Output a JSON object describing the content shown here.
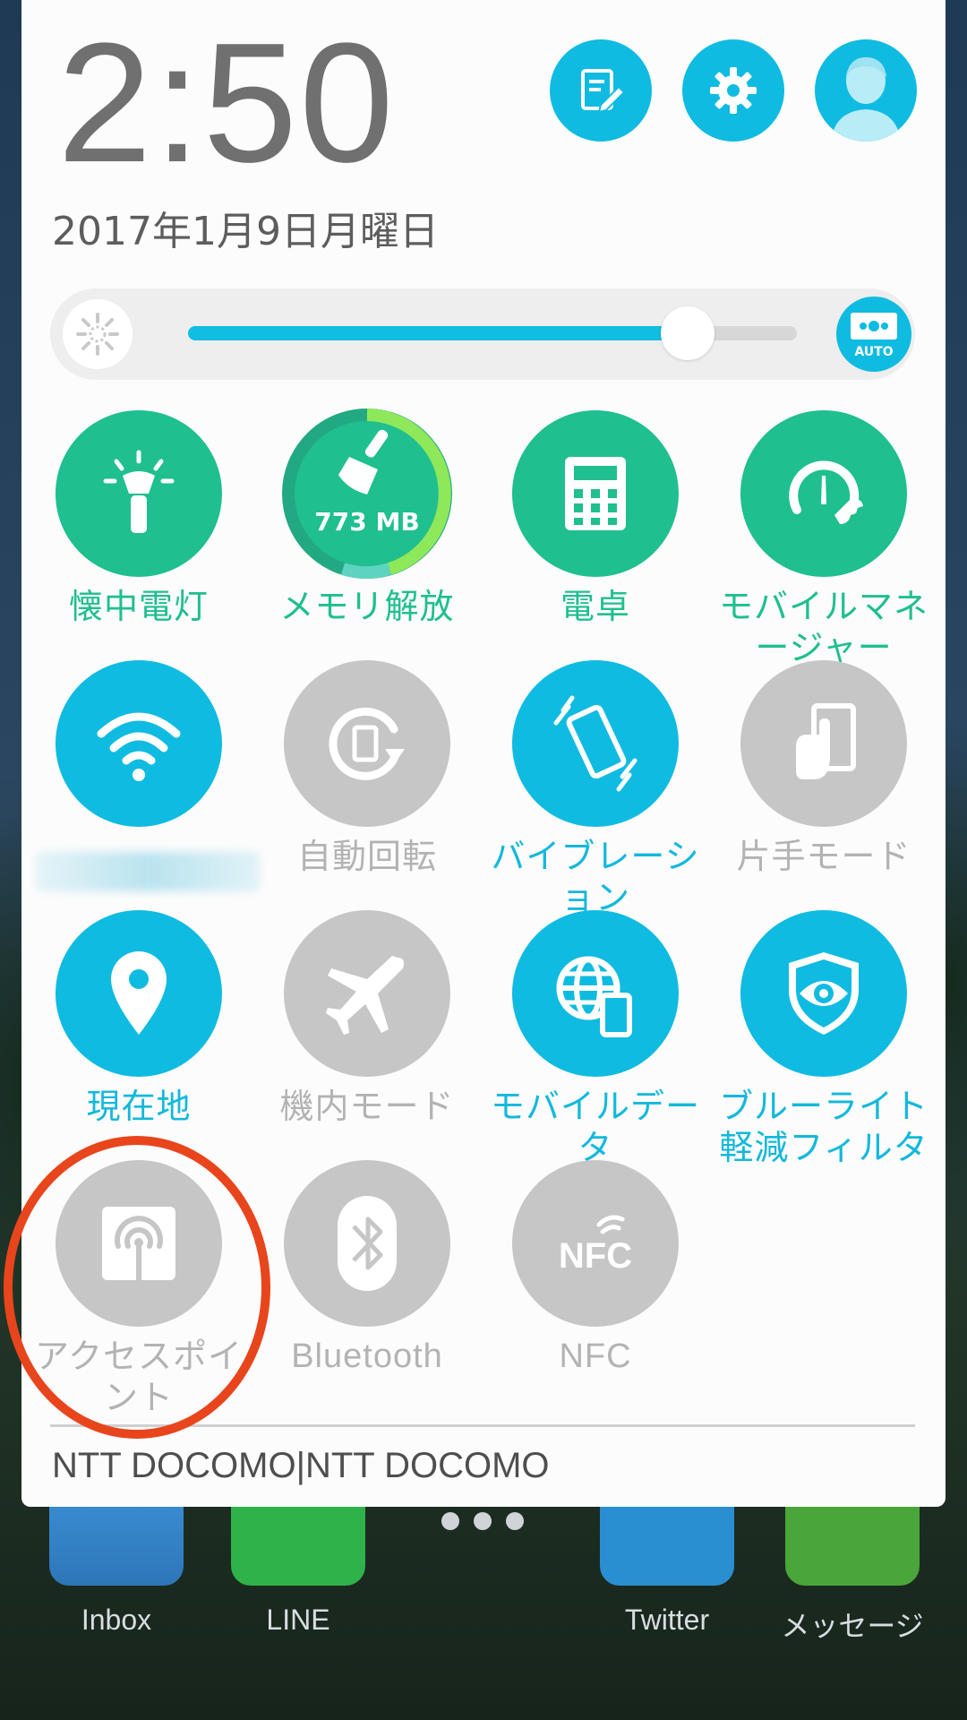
{
  "status": {
    "time": "2:50",
    "date": "2017年1月9日月曜日"
  },
  "header_buttons": [
    {
      "name": "edit-quick-settings",
      "icon": "edit-icon"
    },
    {
      "name": "settings",
      "icon": "gear-icon"
    },
    {
      "name": "user",
      "icon": "user-avatar-icon"
    }
  ],
  "brightness": {
    "level_fraction": 0.82,
    "auto_label": "AUTO"
  },
  "tiles": [
    {
      "label": "懐中電灯",
      "icon": "flashlight-icon",
      "state": "on-green"
    },
    {
      "label": "メモリ解放",
      "icon": "broom-icon",
      "state": "on-green",
      "value": "773 MB"
    },
    {
      "label": "電卓",
      "icon": "calculator-icon",
      "state": "on-green"
    },
    {
      "label": "モバイルマネージャー",
      "icon": "mobile-manager-icon",
      "state": "on-green"
    },
    {
      "label": "",
      "icon": "wifi-icon",
      "state": "on-blue"
    },
    {
      "label": "自動回転",
      "icon": "auto-rotate-icon",
      "state": "off"
    },
    {
      "label": "バイブレーション",
      "icon": "vibration-icon",
      "state": "on-blue"
    },
    {
      "label": "片手モード",
      "icon": "one-hand-mode-icon",
      "state": "off"
    },
    {
      "label": "現在地",
      "icon": "location-pin-icon",
      "state": "on-blue"
    },
    {
      "label": "機内モード",
      "icon": "airplane-icon",
      "state": "off"
    },
    {
      "label": "モバイルデータ",
      "icon": "mobile-data-icon",
      "state": "on-blue"
    },
    {
      "label": "ブルーライト軽減フィルタ",
      "icon": "eye-shield-icon",
      "state": "on-blue"
    },
    {
      "label": "アクセスポイント",
      "icon": "hotspot-icon",
      "state": "off"
    },
    {
      "label": "Bluetooth",
      "icon": "bluetooth-icon",
      "state": "off"
    },
    {
      "label": "NFC",
      "icon": "nfc-icon",
      "state": "off"
    }
  ],
  "carrier": "NTT DOCOMO|NTT DOCOMO",
  "dock": [
    {
      "label": "Inbox",
      "icon": "inbox-icon"
    },
    {
      "label": "LINE",
      "icon": "line-icon"
    },
    {
      "label": "",
      "icon": "app-drawer-icon"
    },
    {
      "label": "Twitter",
      "icon": "twitter-icon"
    },
    {
      "label": "メッセージ",
      "icon": "messages-icon"
    }
  ],
  "colors": {
    "accent_blue": "#0fbbe1",
    "accent_green": "#1fbf8f",
    "inactive_gray": "#c6c6c6",
    "highlight_red": "#e8451c"
  }
}
